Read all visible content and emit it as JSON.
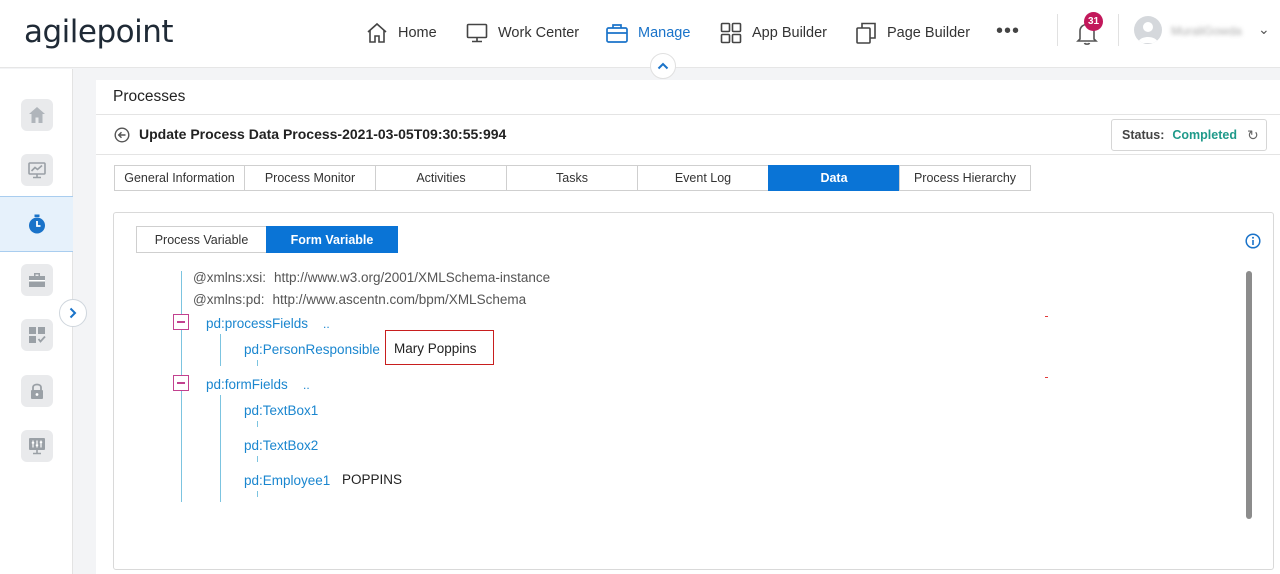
{
  "brand": {
    "logo_text": "agilepoint"
  },
  "nav": {
    "items": [
      {
        "label": "Home",
        "icon": "home-icon"
      },
      {
        "label": "Work Center",
        "icon": "monitor-icon"
      },
      {
        "label": "Manage",
        "icon": "briefcase-icon",
        "active": true
      },
      {
        "label": "App Builder",
        "icon": "grid-icon"
      },
      {
        "label": "Page Builder",
        "icon": "pages-icon"
      }
    ],
    "more": "•••",
    "notification_count": "31",
    "username": "MuraliGowda",
    "accent_color": "#1a73c9"
  },
  "page": {
    "title": "Processes",
    "process_title": "Update Process Data Process-2021-03-05T09:30:55:994",
    "status_label": "Status:",
    "status_value": "Completed",
    "status_color": "#1f9a8a"
  },
  "tabs": [
    "General Information",
    "Process Monitor",
    "Activities",
    "Tasks",
    "Event Log",
    "Data",
    "Process Hierarchy"
  ],
  "active_tab": "Data",
  "subtabs": [
    "Process Variable",
    "Form Variable"
  ],
  "active_subtab": "Form Variable",
  "xml": {
    "attrs": [
      {
        "key": "@xmlns:xsi:",
        "value": "http://www.w3.org/2001/XMLSchema-instance"
      },
      {
        "key": "@xmlns:pd:",
        "value": "http://www.ascentn.com/bpm/XMLSchema"
      }
    ],
    "process_fields": {
      "label": "pd:processFields",
      "dots": "..",
      "children": [
        {
          "label": "pd:PersonResponsible",
          "value": "Mary Poppins"
        }
      ]
    },
    "form_fields": {
      "label": "pd:formFields",
      "dots": "..",
      "children": [
        {
          "label": "pd:TextBox1",
          "value": ""
        },
        {
          "label": "pd:TextBox2",
          "value": ""
        },
        {
          "label": "pd:Employee1",
          "value": "POPPINS"
        }
      ]
    }
  }
}
